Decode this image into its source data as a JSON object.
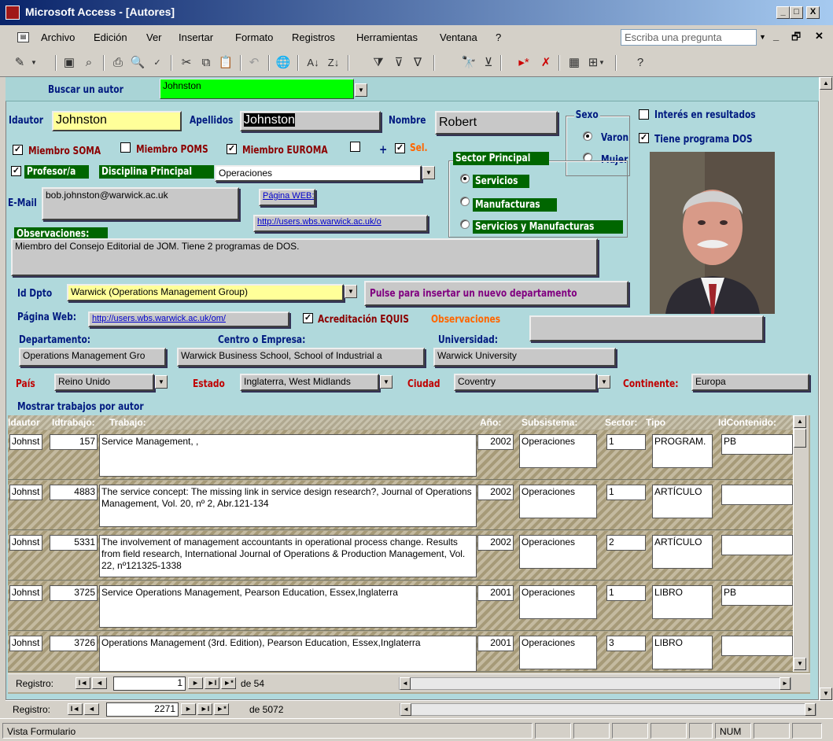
{
  "window": {
    "title": "Microsoft Access - [Autores]",
    "min": "_",
    "max": "□",
    "close": "X",
    "doc_restore": "🗗",
    "doc_min": "_",
    "doc_close": "✕"
  },
  "menu": {
    "items": [
      "Archivo",
      "Edición",
      "Ver",
      "Insertar",
      "Formato",
      "Registros",
      "Herramientas",
      "Ventana",
      "?"
    ],
    "ask_placeholder": "Escriba una pregunta"
  },
  "toolbar": {
    "icons": [
      "design-view-icon",
      "save-icon",
      "search-file-icon",
      "print-icon",
      "print-preview-icon",
      "spelling-icon",
      "cut-icon",
      "copy-icon",
      "paste-icon",
      "undo-icon",
      "hyperlink-icon",
      "sort-ascending-icon",
      "sort-descending-icon",
      "filter-by-selection-icon",
      "filter-by-form-icon",
      "apply-filter-icon",
      "find-icon",
      "advanced-filter-icon",
      "new-record-icon",
      "delete-record-icon",
      "database-window-icon",
      "new-object-icon",
      "help-icon"
    ]
  },
  "search": {
    "label": "Buscar un autor",
    "value": "Johnston"
  },
  "author": {
    "idautor_label": "Idautor",
    "idautor": "Johnston",
    "apellidos_label": "Apellidos",
    "apellidos": "Johnston",
    "nombre_label": "Nombre",
    "nombre": "Robert",
    "email_label": "E-Mail",
    "email": "bob.johnston@warwick.ac.uk",
    "pagina_web_btn": "Página WEB:",
    "pagina_web_url": "http://users.wbs.warwick.ac.uk/o",
    "observaciones_label": "Observaciones:",
    "observaciones": "Miembro del Consejo Editorial de JOM. Tiene 2 programas de DOS."
  },
  "checks": {
    "soma": "Miembro SOMA",
    "poms": "Miembro POMS",
    "euroma": "Miembro EUROMA",
    "plus": "+",
    "sel": "Sel.",
    "profesor": "Profesor/a",
    "interes": "Interés en resultados",
    "programa_dos": "Tiene programa DOS",
    "equis": "Acreditación EQUIS",
    "check_mark": "✓"
  },
  "disciplina": {
    "label": "Disciplina Principal",
    "value": "Operaciones"
  },
  "sexo": {
    "label": "Sexo",
    "options": [
      "Varon",
      "Mujer"
    ],
    "selected": "Varon"
  },
  "sector": {
    "label": "Sector Principal",
    "options": [
      "Servicios",
      "Manufacturas",
      "Servicios y Manufacturas"
    ],
    "selected": "Servicios"
  },
  "dpto": {
    "label": "Id Dpto",
    "value": "Warwick (Operations Management Group)",
    "insert_btn": "Pulse para insertar un nuevo departamento",
    "pagina_web_label": "Página Web:",
    "pagina_web_url": "http://users.wbs.warwick.ac.uk/om/",
    "observaciones_label": "Observaciones"
  },
  "org": {
    "departamento_label": "Departamento:",
    "departamento": "Operations Management Gro",
    "centro_label": "Centro o Empresa:",
    "centro": "Warwick Business School, School of Industrial a",
    "universidad_label": "Universidad:",
    "universidad": "Warwick University"
  },
  "location": {
    "pais_label": "País",
    "pais": "Reino Unido",
    "estado_label": "Estado",
    "estado": "Inglaterra, West Midlands",
    "ciudad_label": "Ciudad",
    "ciudad": "Coventry",
    "continente_label": "Continente:",
    "continente": "Europa"
  },
  "subform": {
    "title": "Mostrar trabajos por autor",
    "headers": {
      "idautor": "Idautor",
      "idtrabajo": "Idtrabajo:",
      "trabajo": "Trabajo:",
      "ano": "Año:",
      "subsistema": "Subsistema:",
      "sector": "Sector:",
      "tipo": "Tipo",
      "idcontenido": "IdContenido:"
    },
    "rows": [
      {
        "idautor": "Johnst",
        "idtrabajo": "157",
        "trabajo": "Service Management, ,",
        "ano": "2002",
        "subsistema": "Operaciones",
        "sector": "1",
        "tipo": "PROGRAM.",
        "idcontenido": "PB"
      },
      {
        "idautor": "Johnst",
        "idtrabajo": "4883",
        "trabajo": "The service concept: The missing link in service design research?, Journal of Operations Management, Vol. 20, nº 2, Abr.121-134",
        "ano": "2002",
        "subsistema": "Operaciones",
        "sector": "1",
        "tipo": "ARTÍCULO",
        "idcontenido": ""
      },
      {
        "idautor": "Johnst",
        "idtrabajo": "5331",
        "trabajo": "The involvement of management accountants in operational process change. Results from field research, International Journal of Operations & Production Management, Vol. 22, nº121325-1338",
        "ano": "2002",
        "subsistema": "Operaciones",
        "sector": "2",
        "tipo": "ARTÍCULO",
        "idcontenido": ""
      },
      {
        "idautor": "Johnst",
        "idtrabajo": "3725",
        "trabajo": "Service Operations Management, Pearson Education, Essex,Inglaterra",
        "ano": "2001",
        "subsistema": "Operaciones",
        "sector": "1",
        "tipo": "LIBRO",
        "idcontenido": "PB"
      },
      {
        "idautor": "Johnst",
        "idtrabajo": "3726",
        "trabajo": "Operations Management (3rd. Edition), Pearson Education, Essex,Inglaterra",
        "ano": "2001",
        "subsistema": "Operaciones",
        "sector": "3",
        "tipo": "LIBRO",
        "idcontenido": ""
      }
    ],
    "nav": {
      "label": "Registro:",
      "current": "1",
      "of": "de 54"
    }
  },
  "mainnav": {
    "label": "Registro:",
    "current": "2271",
    "of": "de 5072"
  },
  "nav_glyphs": {
    "first": "I◄",
    "prev": "◄",
    "next": "►",
    "last": "►I",
    "new": "►*"
  },
  "status": {
    "text": "Vista Formulario",
    "num": "NUM"
  }
}
